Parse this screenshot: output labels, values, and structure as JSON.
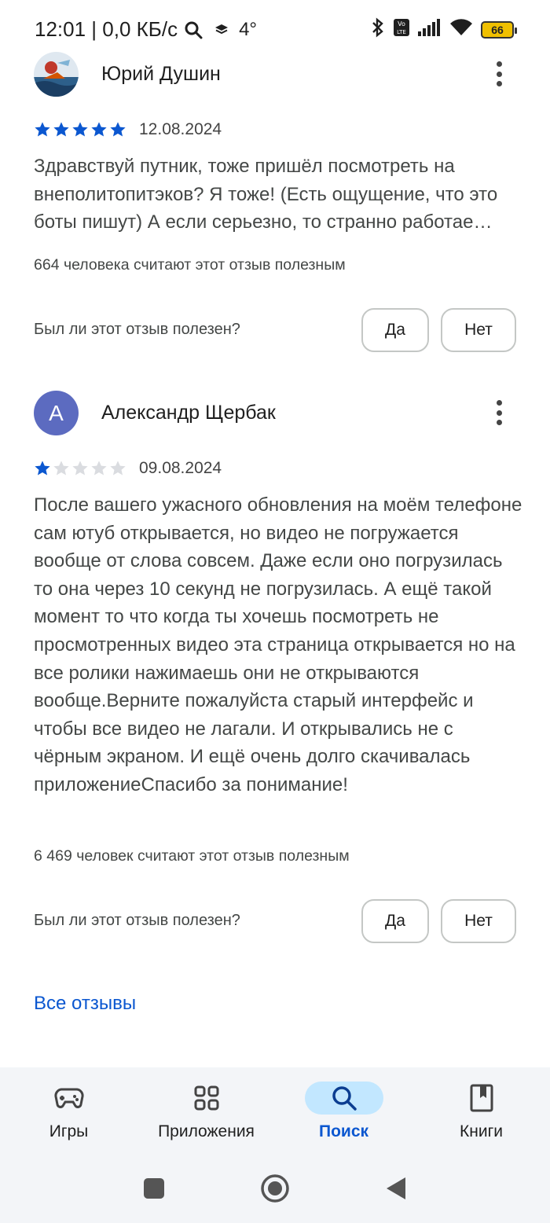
{
  "status_bar": {
    "time_speed": "12:01 | 0,0 КБ/с",
    "temperature": "4°",
    "battery": "66"
  },
  "reviews": [
    {
      "author": "Юрий Душин",
      "avatar_letter": "",
      "stars": 5,
      "date": "12.08.2024",
      "text": "Здравствуй путник, тоже пришёл посмотреть на внеполитопитэков? Я тоже! (Есть ощущение, что это боты пишут) А если серьезно, то странно работае…",
      "helpful_count": "664 человека считают этот отзыв полезным",
      "question": "Был ли этот отзыв полезен?",
      "yes_label": "Да",
      "no_label": "Нет"
    },
    {
      "author": "Александр Щербак",
      "avatar_letter": "А",
      "stars": 1,
      "date": "09.08.2024",
      "text": "После вашего ужасного обновления на моём телефоне сам ютуб открывается, но видео не погружается вообще от слова совсем. Даже если оно погрузилась то она через 10 секунд не погрузилась. А ещё такой момент то что когда ты хочешь посмотреть не просмотренных видео эта страница открывается но на все ролики нажимаешь они не открываются вообще.Верните пожалуйста старый интерфейс и чтобы все видео не лагали. И открывались не с чёрным экраном. И ещё очень долго скачивалась приложениеСпасибо за понимание!",
      "helpful_count": "6 469 человек считают этот отзыв полезным",
      "question": "Был ли этот отзыв полезен?",
      "yes_label": "Да",
      "no_label": "Нет"
    }
  ],
  "all_reviews_label": "Все отзывы",
  "bottom_nav": {
    "items": [
      {
        "label": "Игры",
        "icon": "gamepad-icon"
      },
      {
        "label": "Приложения",
        "icon": "apps-grid-icon"
      },
      {
        "label": "Поиск",
        "icon": "search-icon",
        "active": true
      },
      {
        "label": "Книги",
        "icon": "book-icon"
      }
    ]
  },
  "colors": {
    "accent": "#0b57d0",
    "star_filled": "#0b57d0",
    "star_empty": "#dadce0",
    "active_pill": "#c2e7ff",
    "avatar_letter_bg": "#5c6bc0"
  }
}
